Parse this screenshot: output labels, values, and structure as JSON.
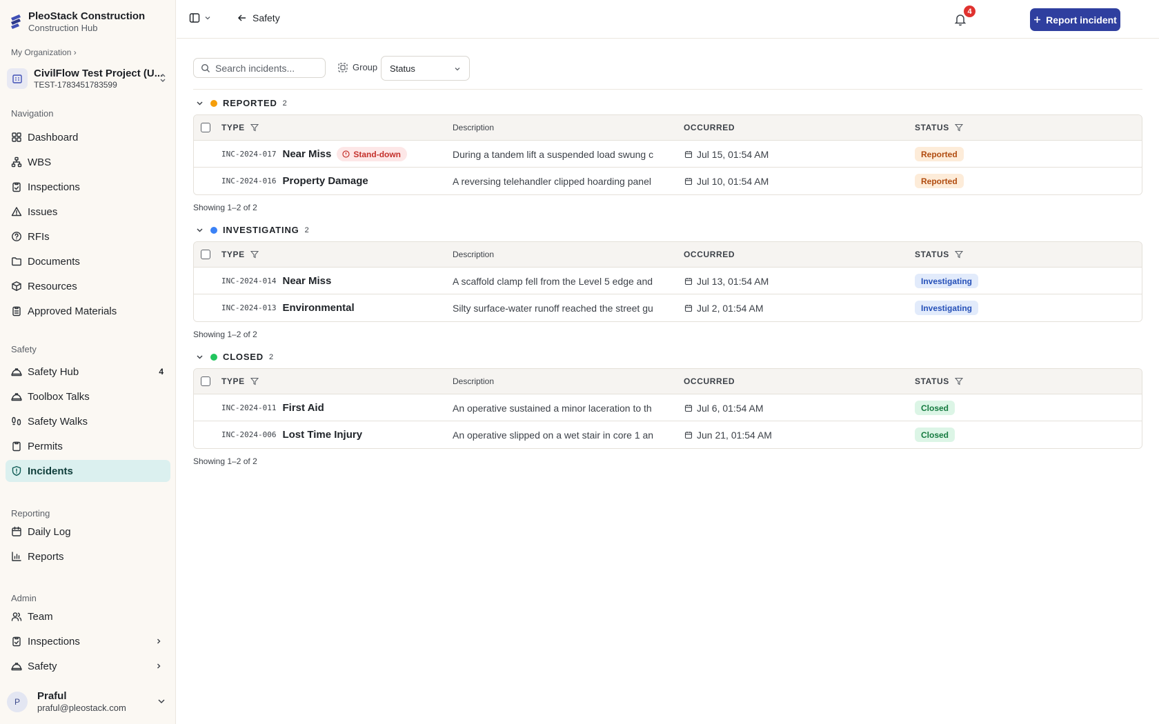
{
  "org": {
    "name": "PleoStack Construction",
    "subtitle": "Construction Hub"
  },
  "breadcrumb": "My Organization ›",
  "project": {
    "name": "CivilFlow Test Project (U...",
    "code": "TEST-1783451783599"
  },
  "nav": {
    "navigation_label": "Navigation",
    "navigation": [
      {
        "label": "Dashboard",
        "icon": "grid-icon"
      },
      {
        "label": "WBS",
        "icon": "hierarchy-icon"
      },
      {
        "label": "Inspections",
        "icon": "clipboard-check-icon"
      },
      {
        "label": "Issues",
        "icon": "warning-icon"
      },
      {
        "label": "RFIs",
        "icon": "question-circle-icon"
      },
      {
        "label": "Documents",
        "icon": "folder-icon"
      },
      {
        "label": "Resources",
        "icon": "box-icon"
      },
      {
        "label": "Approved Materials",
        "icon": "clipboard-list-icon"
      }
    ],
    "safety_label": "Safety",
    "safety": [
      {
        "label": "Safety Hub",
        "icon": "hardhat-icon",
        "count": "4"
      },
      {
        "label": "Toolbox Talks",
        "icon": "hardhat-icon"
      },
      {
        "label": "Safety Walks",
        "icon": "footprints-icon"
      },
      {
        "label": "Permits",
        "icon": "clipboard-icon"
      },
      {
        "label": "Incidents",
        "icon": "shield-alert-icon",
        "active": true
      }
    ],
    "reporting_label": "Reporting",
    "reporting": [
      {
        "label": "Daily Log",
        "icon": "calendar-icon"
      },
      {
        "label": "Reports",
        "icon": "bar-chart-icon"
      }
    ],
    "admin_label": "Admin",
    "admin": [
      {
        "label": "Team",
        "icon": "users-icon"
      },
      {
        "label": "Inspections",
        "icon": "clipboard-check-icon"
      },
      {
        "label": "Safety",
        "icon": "hardhat-icon"
      }
    ]
  },
  "user": {
    "initial": "P",
    "name": "Praful",
    "email": "praful@pleostack.com"
  },
  "topbar": {
    "back_label": "Safety",
    "report_button": "Report incident",
    "notification_count": "4"
  },
  "toolbar": {
    "search_placeholder": "Search incidents...",
    "group_label": "Group",
    "group_value": "Status"
  },
  "columns": {
    "type": "TYPE",
    "description": "Description",
    "occurred": "OCCURRED",
    "status": "STATUS"
  },
  "groups": [
    {
      "name": "REPORTED",
      "count": "2",
      "color": "#f59e0b",
      "showing": "Showing 1–2 of 2",
      "rows": [
        {
          "code": "INC-2024-017",
          "type": "Near Miss",
          "tag": "Stand-down",
          "description": "During a tandem lift a suspended load swung c",
          "occurred": "Jul 15, 01:54 AM",
          "status": "Reported",
          "status_kind": "reported"
        },
        {
          "code": "INC-2024-016",
          "type": "Property Damage",
          "description": "A reversing telehandler clipped hoarding panel",
          "occurred": "Jul 10, 01:54 AM",
          "status": "Reported",
          "status_kind": "reported"
        }
      ]
    },
    {
      "name": "INVESTIGATING",
      "count": "2",
      "color": "#3b82f6",
      "showing": "Showing 1–2 of 2",
      "rows": [
        {
          "code": "INC-2024-014",
          "type": "Near Miss",
          "description": "A scaffold clamp fell from the Level 5 edge and",
          "occurred": "Jul 13, 01:54 AM",
          "status": "Investigating",
          "status_kind": "investigating"
        },
        {
          "code": "INC-2024-013",
          "type": "Environmental",
          "description": "Silty surface-water runoff reached the street gu",
          "occurred": "Jul 2, 01:54 AM",
          "status": "Investigating",
          "status_kind": "investigating"
        }
      ]
    },
    {
      "name": "CLOSED",
      "count": "2",
      "color": "#22c55e",
      "showing": "Showing 1–2 of 2",
      "rows": [
        {
          "code": "INC-2024-011",
          "type": "First Aid",
          "description": "An operative sustained a minor laceration to th",
          "occurred": "Jul 6, 01:54 AM",
          "status": "Closed",
          "status_kind": "closed"
        },
        {
          "code": "INC-2024-006",
          "type": "Lost Time Injury",
          "description": "An operative slipped on a wet stair in core 1 an",
          "occurred": "Jun 21, 01:54 AM",
          "status": "Closed",
          "status_kind": "closed"
        }
      ]
    }
  ]
}
